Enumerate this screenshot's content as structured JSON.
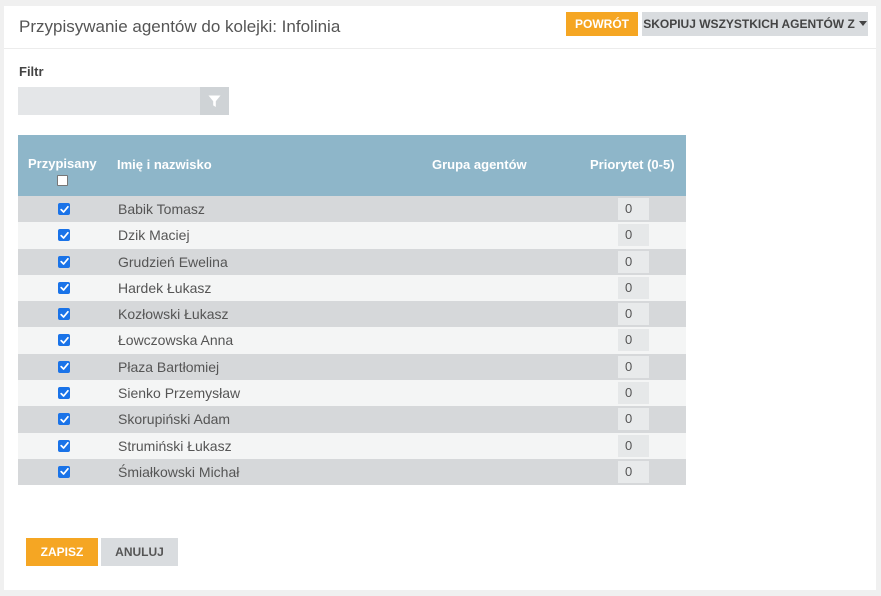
{
  "header": {
    "title": "Przypisywanie agentów do kolejki: Infolinia",
    "back_label": "POWRÓT",
    "copy_label": "SKOPIUJ WSZYSTKICH AGENTÓW Z"
  },
  "filter": {
    "label": "Filtr",
    "value": "",
    "placeholder": ""
  },
  "table": {
    "columns": {
      "assigned": "Przypisany",
      "name": "Imię i nazwisko",
      "group": "Grupa agentów",
      "priority": "Priorytet (0-5)"
    },
    "rows": [
      {
        "assigned": true,
        "name": "Babik Tomasz",
        "group": "",
        "priority": "0"
      },
      {
        "assigned": true,
        "name": "Dzik Maciej",
        "group": "",
        "priority": "0"
      },
      {
        "assigned": true,
        "name": "Grudzień Ewelina",
        "group": "",
        "priority": "0"
      },
      {
        "assigned": true,
        "name": "Hardek Łukasz",
        "group": "",
        "priority": "0"
      },
      {
        "assigned": true,
        "name": "Kozłowski Łukasz",
        "group": "",
        "priority": "0"
      },
      {
        "assigned": true,
        "name": "Łowczowska Anna",
        "group": "",
        "priority": "0"
      },
      {
        "assigned": true,
        "name": "Płaza Bartłomiej",
        "group": "",
        "priority": "0"
      },
      {
        "assigned": true,
        "name": "Sienko Przemysław",
        "group": "",
        "priority": "0"
      },
      {
        "assigned": true,
        "name": "Skorupiński Adam",
        "group": "",
        "priority": "0"
      },
      {
        "assigned": true,
        "name": "Strumiński Łukasz",
        "group": "",
        "priority": "0"
      },
      {
        "assigned": true,
        "name": "Śmiałkowski Michał",
        "group": "",
        "priority": "0"
      }
    ]
  },
  "footer": {
    "save_label": "ZAPISZ",
    "cancel_label": "ANULUJ"
  },
  "colors": {
    "accent": "#f5a623",
    "table_header": "#8eb6c9",
    "checkbox": "#1a73e8"
  },
  "icons": {
    "filter": "filter-icon",
    "caret": "caret-down-icon",
    "check": "check-icon"
  }
}
